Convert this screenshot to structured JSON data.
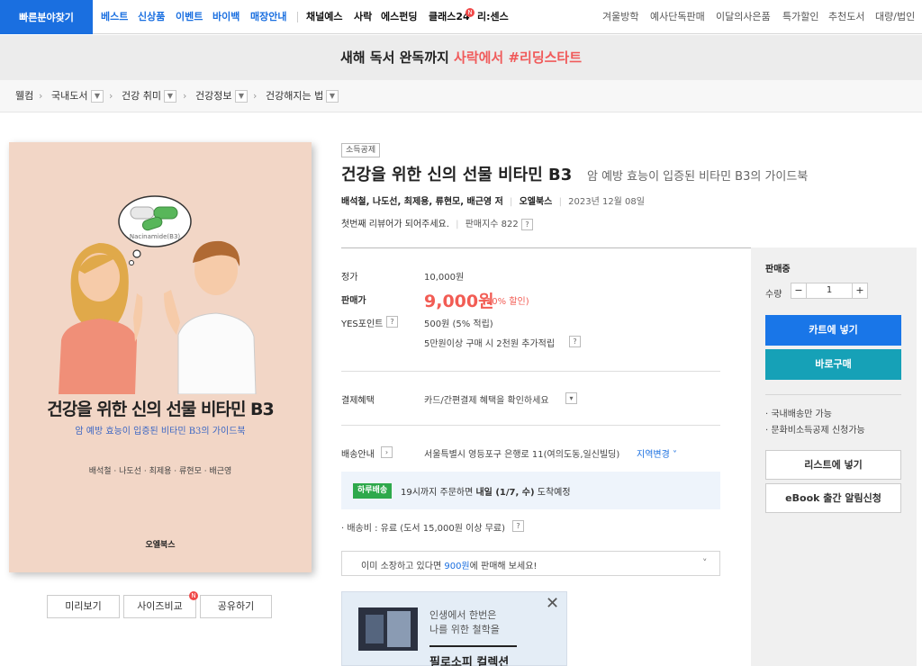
{
  "nav": {
    "quick_find": "빠른분야찾기",
    "primary": [
      "베스트",
      "신상품",
      "이벤트",
      "바이백",
      "매장안내"
    ],
    "secondary": [
      "채널예스",
      "사락",
      "에스펀딩",
      "클래스24",
      "리:센스"
    ],
    "new_dot": "N",
    "right": [
      "겨울방학",
      "예사단독판매",
      "이달의사은품",
      "특가할인",
      "추천도서",
      "대량/법인"
    ]
  },
  "banner": {
    "prefix": "새해 독서 완독까지 ",
    "highlight": "사락에서 #리딩스타트"
  },
  "breadcrumb": [
    "웰컴",
    "국내도서",
    "건강 취미",
    "건강정보",
    "건강해지는 법"
  ],
  "cover": {
    "bubble_label": "Nacinamide(B3)",
    "title": "건강을 위한 신의 선물 비타민 B3",
    "subtitle": "암 예방 효능이 입증된 비타민 B3의 가이드북",
    "authors": "배석철 · 나도선 · 최제용 · 류현모 · 배근영",
    "publisher": "오엘북스"
  },
  "cover_buttons": {
    "preview": "미리보기",
    "size_compare": "사이즈비교",
    "share": "공유하기"
  },
  "product": {
    "badge": "소득공제",
    "title": "건강을 위한 신의 선물 비타민 B3",
    "subtitle": "암 예방 효능이 입증된 비타민 B3의 가이드북",
    "authors": "배석철, 나도선, 최제용, 류현모, 배근영 저",
    "publisher": "오엘북스",
    "date": "2023년 12월 08일",
    "review": "첫번째 리뷰어가 되어주세요.",
    "sales_index": "판매지수 822",
    "help": "?"
  },
  "price": {
    "list_label": "정가",
    "list_value": "10,000원",
    "sale_label": "판매가",
    "sale_value": "9,000원",
    "discount": "(10% 할인)",
    "points_label": "YES포인트",
    "points_value": "500원 (5% 적립)",
    "points_extra": "5만원이상 구매 시 2천원 추가적립"
  },
  "payment": {
    "label": "결제혜택",
    "value": "카드/간편결제 혜택을 확인하세요"
  },
  "shipping": {
    "label": "배송안내",
    "address": "서울특별시 영등포구 은행로 11(여의도동,일신빌딩)",
    "change": "지역변경",
    "badge": "하루배송",
    "text_pre": "19시까지 주문하면 ",
    "text_bold": "내일 (1/7, 수)",
    "text_post": " 도착예정",
    "fee": "배송비 : 유료 (도서 15,000원 이상 무료)"
  },
  "resell": {
    "pre": "이미 소장하고 있다면 ",
    "amount": "900원",
    "post": "에 판매해 보세요!"
  },
  "ad": {
    "line1": "인생에서 한번은",
    "line2": "나를 위한 철학을",
    "title": "필로소피 컬렉션"
  },
  "panel": {
    "status": "판매중",
    "qty_label": "수량",
    "qty_value": "1",
    "cart": "카트에 넣기",
    "buy_now": "바로구매",
    "note1": "국내배송만 가능",
    "note2": "문화비소득공제 신청가능",
    "list_add": "리스트에 넣기",
    "ebook_alert": "eBook 출간 알림신청"
  },
  "colors": {
    "brand_blue": "#1a6fe0",
    "price_red": "#f25c54",
    "buy_teal": "#16a1b7",
    "same_day_green": "#2ea94b"
  }
}
